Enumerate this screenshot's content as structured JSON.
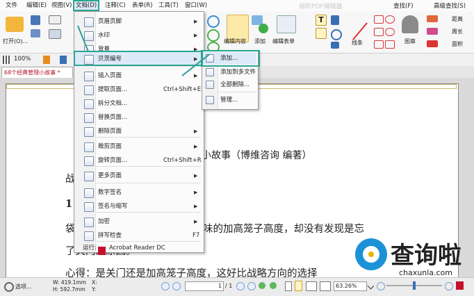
{
  "menubar": {
    "items": [
      "文件",
      "编辑(E)",
      "视图(V)",
      "文档(D)",
      "注释(C)",
      "表单(R)",
      "工具(T)",
      "窗口(W)"
    ],
    "title_ghost": "福昕PDF编辑器",
    "right": [
      "查找(F)",
      "高级查找(S)"
    ]
  },
  "ribbon": {
    "open_label": "打开(O)...",
    "add_label": "添加",
    "edit_form_label": "编辑表单",
    "edit_content_label": "编辑内容",
    "line_label": "线条",
    "stamp_label": "图章",
    "distance_label": "距离",
    "perimeter_label": "周长",
    "area_label": "面积"
  },
  "toolbar2": {
    "zoom": "100%"
  },
  "tab": {
    "title": "68个经典管理小故事 *"
  },
  "doc_menu": {
    "items": [
      {
        "label": "页眉页脚",
        "shortcut": "",
        "sub": true
      },
      {
        "label": "水印",
        "shortcut": "",
        "sub": true
      },
      {
        "label": "背景",
        "shortcut": "",
        "sub": true
      },
      {
        "label": "贝茨编号",
        "shortcut": "",
        "sub": true
      },
      {
        "label": "插入页面",
        "shortcut": "",
        "sub": true
      },
      {
        "label": "提取页面...",
        "shortcut": "Ctrl+Shift+E",
        "sub": false
      },
      {
        "label": "拆分文档...",
        "shortcut": "",
        "sub": false
      },
      {
        "label": "替换页面...",
        "shortcut": "",
        "sub": false
      },
      {
        "label": "删除页面",
        "shortcut": "",
        "sub": true
      },
      {
        "label": "裁剪页面",
        "shortcut": "",
        "sub": true
      },
      {
        "label": "旋转页面...",
        "shortcut": "Ctrl+Shift+R",
        "sub": false
      },
      {
        "label": "更多页面",
        "shortcut": "",
        "sub": true
      },
      {
        "label": "数字签名",
        "shortcut": "",
        "sub": true
      },
      {
        "label": "签名与缩写",
        "shortcut": "",
        "sub": true
      },
      {
        "label": "加密",
        "shortcut": "",
        "sub": true
      },
      {
        "label": "拼写检查",
        "shortcut": "F7",
        "sub": false
      }
    ],
    "run_label": "运行:",
    "run_app": "Acrobat Reader DC"
  },
  "bates_menu": {
    "items": [
      "添加...",
      "添加到多文件",
      "全部删除...",
      "管理..."
    ]
  },
  "document": {
    "line_title": "小故事（博维咨询   编著）",
    "line_a": "战",
    "line_b": "1",
    "line_c_pre": "袋",
    "line_c": "味的加高笼子高度，却没有发现是忘",
    "line_d": "了关門的原因。",
    "line_e": "心得：是关门还是加高笼子高度，这好比战略方向的选择"
  },
  "status": {
    "options": "选项...",
    "width": "W: 419.1mm",
    "height": "H: 592.7mm",
    "x": "X:",
    "y": "Y:",
    "page": "1",
    "page_total": "/ 1",
    "zoom": "63.26%"
  },
  "watermark": {
    "brand": "查询啦",
    "site": "chaxunla.com"
  },
  "colors": {
    "accent": "#2aa58f",
    "highlight": "#dceaf8",
    "pdf_red": "#c8102e",
    "wm_blue": "#1c92d6"
  }
}
